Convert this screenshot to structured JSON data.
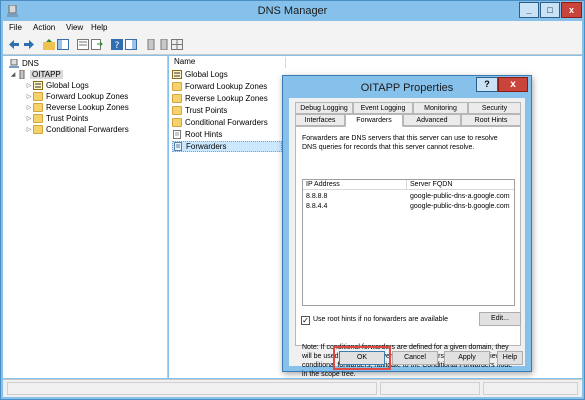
{
  "window": {
    "title": "DNS Manager",
    "min": "_",
    "max": "□",
    "close": "x"
  },
  "menu": {
    "file": "File",
    "action": "Action",
    "view": "View",
    "help": "Help"
  },
  "toolbar": {
    "icons": [
      "back-arrow-icon",
      "forward-arrow-icon",
      "up-folder-icon",
      "show-tree-icon",
      "properties-icon",
      "refresh-icon",
      "export-list-icon",
      "help-icon",
      "console-tree-icon",
      "server-icon",
      "grid-icon"
    ]
  },
  "tree": {
    "root": "DNS",
    "server": "OITAPP",
    "items": [
      "Global Logs",
      "Forward Lookup Zones",
      "Reverse Lookup Zones",
      "Trust Points",
      "Conditional Forwarders"
    ]
  },
  "list": {
    "header": "Name",
    "items": [
      "Global Logs",
      "Forward Lookup Zones",
      "Reverse Lookup Zones",
      "Trust Points",
      "Conditional Forwarders",
      "Root Hints",
      "Forwarders"
    ]
  },
  "dialog": {
    "title": "OITAPP Properties",
    "help_label": "?",
    "close_label": "x",
    "tabs_row1": [
      "Debug Logging",
      "Event Logging",
      "Monitoring",
      "Security"
    ],
    "tabs_row2": [
      "Interfaces",
      "Forwarders",
      "Advanced",
      "Root Hints"
    ],
    "active_tab": "Forwarders",
    "description": "Forwarders are DNS servers that this server can use to resolve DNS queries for records that this server cannot resolve.",
    "table": {
      "columns": [
        "IP Address",
        "Server FQDN"
      ],
      "rows": [
        [
          "8.8.8.8",
          "google-public-dns-a.google.com"
        ],
        [
          "8.8.4.4",
          "google-public-dns-b.google.com"
        ]
      ]
    },
    "use_root_hints_label": "Use root hints if no forwarders are available",
    "use_root_hints_checked": true,
    "check_mark": "✓",
    "edit_label": "Edit...",
    "note": "Note: If conditional forwarders are defined for a given domain, they will be used instead of server-level forwarders.  To create or view conditional forwarders, navigate to the Conditional Forwarders node in the scope tree.",
    "ok": "OK",
    "cancel": "Cancel",
    "apply": "Apply",
    "help": "Help"
  },
  "colors": {
    "title_bar": "#85c1ea",
    "close_red": "#c9443a",
    "selection": "#cce8ff",
    "highlight_box": "#e04a45"
  }
}
